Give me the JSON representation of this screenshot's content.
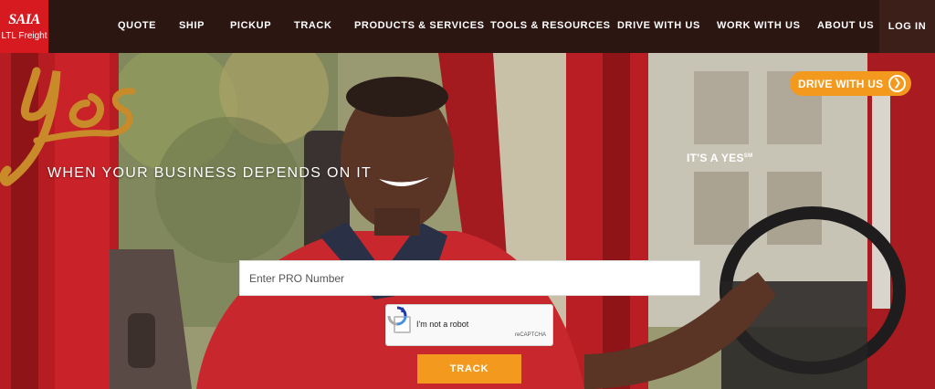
{
  "brand": {
    "logo_text": "SAIA",
    "logo_sub": "LTL Freight",
    "red": "#d71920",
    "orange": "#f39a1e",
    "nav_bg": "#2b1612"
  },
  "nav": {
    "items": [
      {
        "label": "QUOTE"
      },
      {
        "label": "SHIP"
      },
      {
        "label": "PICKUP"
      },
      {
        "label": "TRACK"
      },
      {
        "label": "PRODUCTS & SERVICES"
      },
      {
        "label": "TOOLS & RESOURCES"
      },
      {
        "label": "DRIVE WITH US"
      },
      {
        "label": "WORK WITH US"
      },
      {
        "label": "ABOUT US"
      }
    ],
    "login_label": "LOG IN"
  },
  "hero": {
    "tagline": "WHEN YOUR BUSINESS DEPENDS ON IT",
    "script_word": "yes",
    "its_a_yes": "IT'S A YES",
    "trademark": "SM",
    "drive_badge": "DRIVE WITH US",
    "drive_badge_icon": "chevron-right-icon"
  },
  "track_form": {
    "pro_placeholder": "Enter PRO Number",
    "pro_value": "",
    "captcha_label": "I'm not a robot",
    "captcha_brand": "reCAPTCHA",
    "submit_label": "TRACK"
  }
}
